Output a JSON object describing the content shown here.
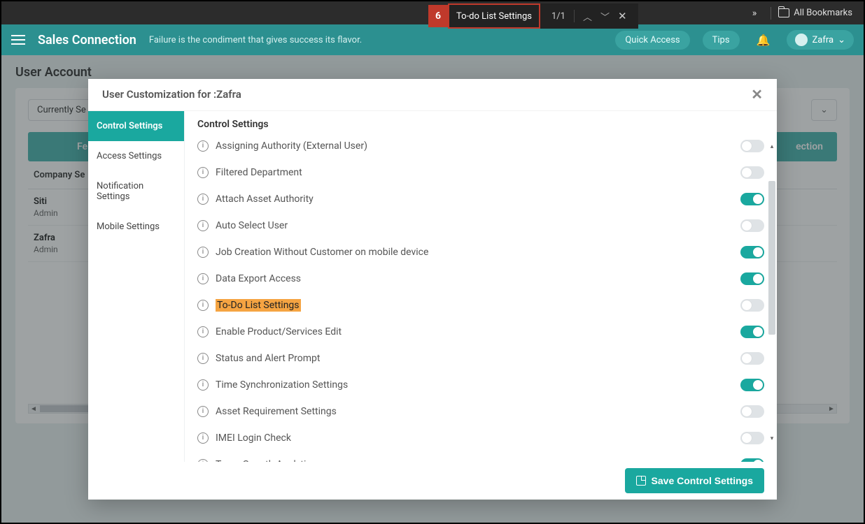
{
  "chrome": {
    "all_bookmarks": "All Bookmarks"
  },
  "find": {
    "badge": "6",
    "query": "To-do List Settings",
    "count": "1/1"
  },
  "header": {
    "brand": "Sales Connection",
    "tagline": "Failure is the condiment that gives success its flavor.",
    "quick_access": "Quick Access",
    "tips": "Tips",
    "user": "Zafra"
  },
  "page": {
    "title": "User Account",
    "filter_left": "Currently Se",
    "tab_left": "Fe",
    "tab_right": "ection",
    "grid_header": "Company Se",
    "rows": [
      {
        "name": "Siti",
        "role": "Admin"
      },
      {
        "name": "Zafra",
        "role": "Admin"
      }
    ]
  },
  "modal": {
    "title_prefix": "User Customization for : ",
    "title_user": "Zafra",
    "tabs": [
      "Control Settings",
      "Access Settings",
      "Notification Settings",
      "Mobile Settings"
    ],
    "panel_title": "Control Settings",
    "settings": [
      {
        "label": "Assigning Authority (External User)",
        "on": false,
        "highlight": false
      },
      {
        "label": "Filtered Department",
        "on": false,
        "highlight": false
      },
      {
        "label": "Attach Asset Authority",
        "on": true,
        "highlight": false
      },
      {
        "label": "Auto Select User",
        "on": false,
        "highlight": false
      },
      {
        "label": "Job Creation Without Customer on mobile device",
        "on": true,
        "highlight": false
      },
      {
        "label": "Data Export Access",
        "on": true,
        "highlight": false
      },
      {
        "label": "To-Do List Settings",
        "on": false,
        "highlight": true
      },
      {
        "label": "Enable Product/Services Edit",
        "on": true,
        "highlight": false
      },
      {
        "label": "Status and Alert Prompt",
        "on": false,
        "highlight": false
      },
      {
        "label": "Time Synchronization Settings",
        "on": true,
        "highlight": false
      },
      {
        "label": "Asset Requirement Settings",
        "on": false,
        "highlight": false
      },
      {
        "label": "IMEI Login Check",
        "on": false,
        "highlight": false
      },
      {
        "label": "Team Growth Analytics",
        "on": true,
        "highlight": false
      }
    ],
    "save_label": "Save Control Settings"
  }
}
